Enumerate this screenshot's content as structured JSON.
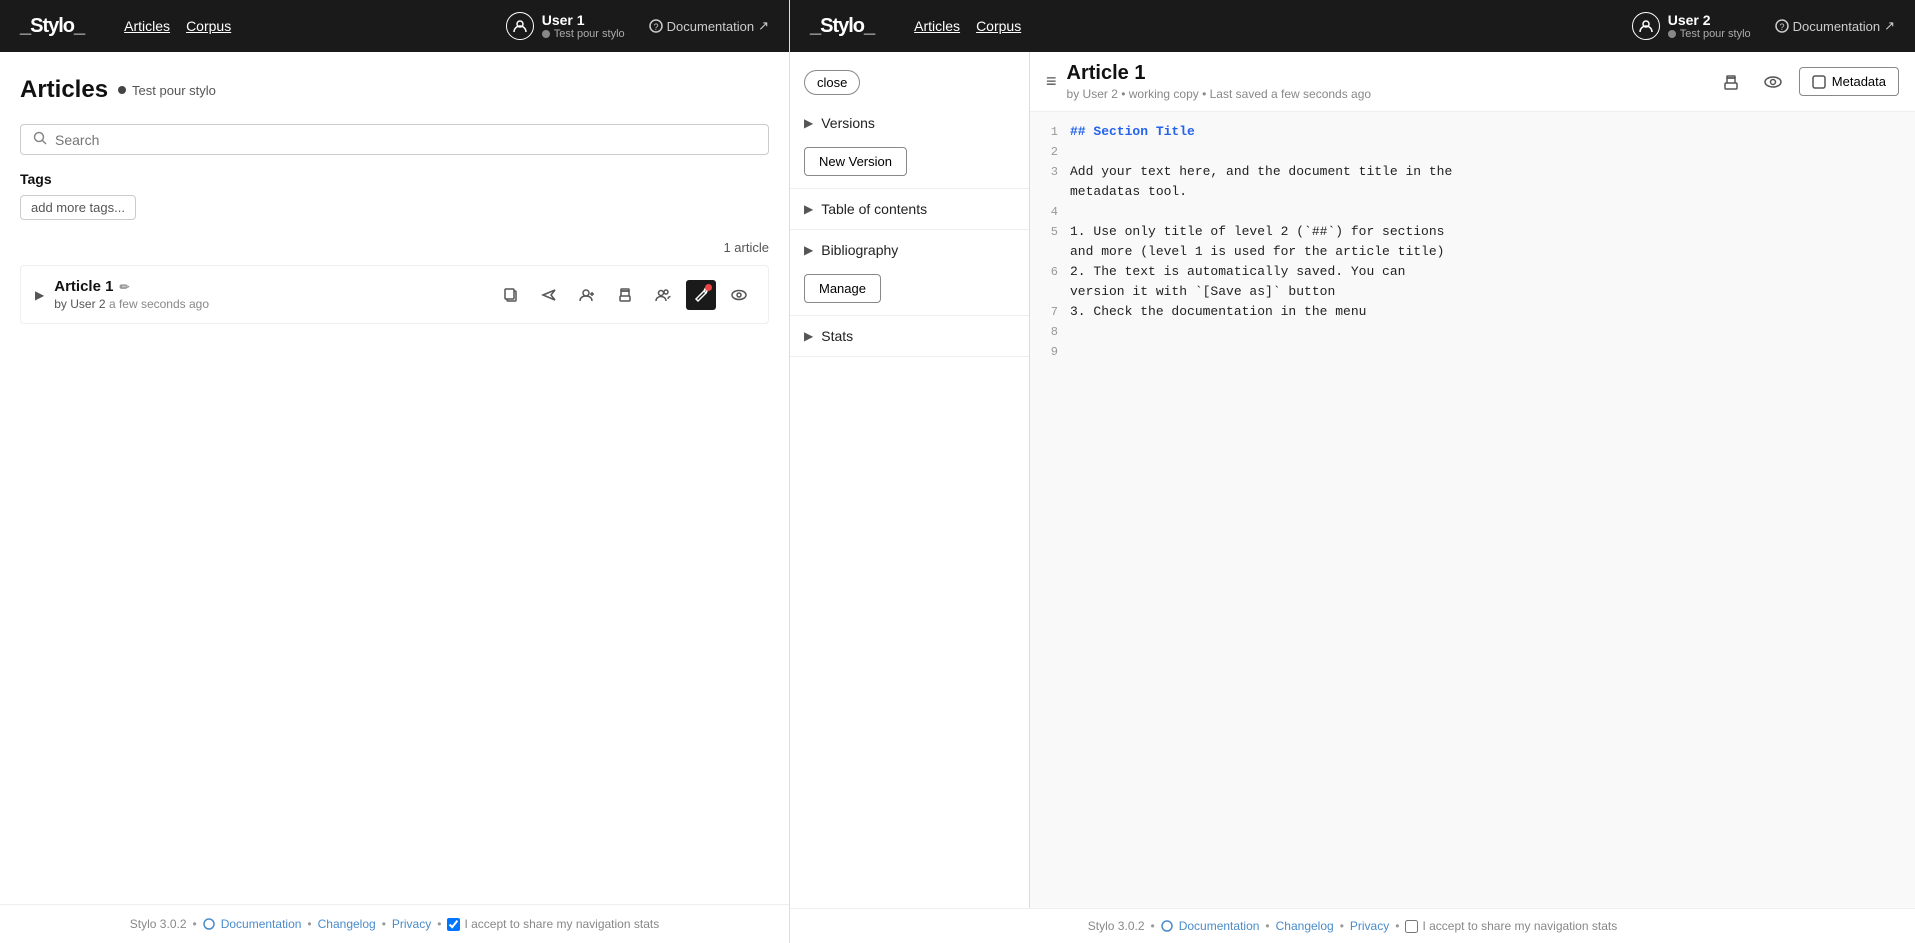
{
  "left": {
    "navbar": {
      "logo": "_Stylo_",
      "nav": [
        {
          "label": "Articles",
          "id": "articles"
        },
        {
          "label": "Corpus",
          "id": "corpus"
        }
      ],
      "user": {
        "name": "User 1",
        "sub": "Test pour stylo"
      },
      "doc_link": "Documentation"
    },
    "page": {
      "heading": "Articles",
      "corpus_badge": "Test pour stylo",
      "search_placeholder": "Search",
      "tags_label": "Tags",
      "add_tags_label": "add more tags...",
      "article_count": "1 article",
      "article": {
        "title": "Article 1",
        "by": "by User 2",
        "timestamp": "a few seconds ago"
      },
      "actions": [
        {
          "id": "copy",
          "icon": "⧉",
          "label": "copy"
        },
        {
          "id": "send",
          "icon": "➤",
          "label": "send"
        },
        {
          "id": "add-user",
          "icon": "➕👤",
          "label": "add user"
        },
        {
          "id": "print",
          "icon": "🖨",
          "label": "print"
        },
        {
          "id": "users",
          "icon": "👥",
          "label": "users"
        },
        {
          "id": "edit",
          "icon": "✏",
          "label": "edit"
        },
        {
          "id": "preview",
          "icon": "👁",
          "label": "preview"
        }
      ]
    },
    "footer": {
      "version": "Stylo 3.0.2",
      "documentation": "Documentation",
      "changelog": "Changelog",
      "privacy": "Privacy",
      "stats_label": "I accept to share my navigation stats"
    }
  },
  "right": {
    "navbar": {
      "logo": "_Stylo_",
      "nav": [
        {
          "label": "Articles",
          "id": "articles"
        },
        {
          "label": "Corpus",
          "id": "corpus"
        }
      ],
      "user": {
        "name": "User 2",
        "sub": "Test pour stylo"
      },
      "doc_link": "Documentation"
    },
    "editor": {
      "close_label": "close",
      "article_title": "Article 1",
      "article_meta": "by User 2  •  working copy  •  Last saved a few seconds ago",
      "metadata_btn": "Metadata",
      "sidebar": {
        "sections": [
          {
            "id": "versions",
            "label": "Versions",
            "action_label": "New Version"
          },
          {
            "id": "table-of-contents",
            "label": "Table of contents"
          },
          {
            "id": "bibliography",
            "label": "Bibliography",
            "action_label": "Manage"
          },
          {
            "id": "stats",
            "label": "Stats"
          }
        ]
      },
      "code_lines": [
        {
          "num": "1",
          "content": "## Section Title",
          "type": "section-title"
        },
        {
          "num": "2",
          "content": "",
          "type": "normal"
        },
        {
          "num": "3",
          "content": "Add your text here, and the document title in the",
          "type": "normal"
        },
        {
          "num": "",
          "content": "metadatas tool.",
          "type": "normal"
        },
        {
          "num": "4",
          "content": "",
          "type": "normal"
        },
        {
          "num": "5",
          "content": "1. Use only title of level 2 (`##`) for sections",
          "type": "normal"
        },
        {
          "num": "",
          "content": "and more (level 1 is used for the article title)",
          "type": "normal"
        },
        {
          "num": "6",
          "content": "2. The text is automatically saved. You can",
          "type": "normal"
        },
        {
          "num": "",
          "content": "version it with `[Save as]` button",
          "type": "normal"
        },
        {
          "num": "7",
          "content": "3. Check the documentation in the menu",
          "type": "normal"
        },
        {
          "num": "8",
          "content": "",
          "type": "normal"
        },
        {
          "num": "9",
          "content": "",
          "type": "normal"
        }
      ]
    },
    "footer": {
      "version": "Stylo 3.0.2",
      "documentation": "Documentation",
      "changelog": "Changelog",
      "privacy": "Privacy",
      "stats_label": "I accept to share my navigation stats"
    }
  }
}
